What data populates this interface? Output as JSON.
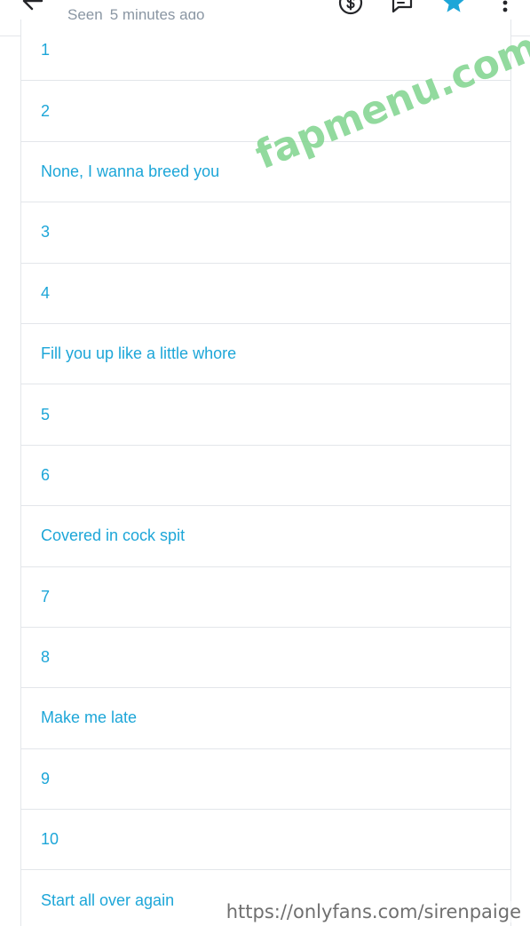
{
  "header": {
    "seen_label": "Seen",
    "seen_time": "5 minutes ago",
    "icons": [
      "back-arrow-icon",
      "dollar-icon",
      "message-icon",
      "star-icon",
      "more-vertical-icon"
    ],
    "accent_color": "#1da6d8"
  },
  "options": [
    {
      "label": "1"
    },
    {
      "label": "2"
    },
    {
      "label": "None, I wanna breed you"
    },
    {
      "label": "3"
    },
    {
      "label": "4"
    },
    {
      "label": "Fill you up like a little whore"
    },
    {
      "label": "5"
    },
    {
      "label": "6"
    },
    {
      "label": "Covered in cock spit"
    },
    {
      "label": "7"
    },
    {
      "label": "8"
    },
    {
      "label": "Make me late"
    },
    {
      "label": "9"
    },
    {
      "label": "10"
    },
    {
      "label": "Start all over again"
    }
  ],
  "watermarks": {
    "site": "fapmenu.com",
    "url": "https://onlyfans.com/sirenpaige"
  }
}
